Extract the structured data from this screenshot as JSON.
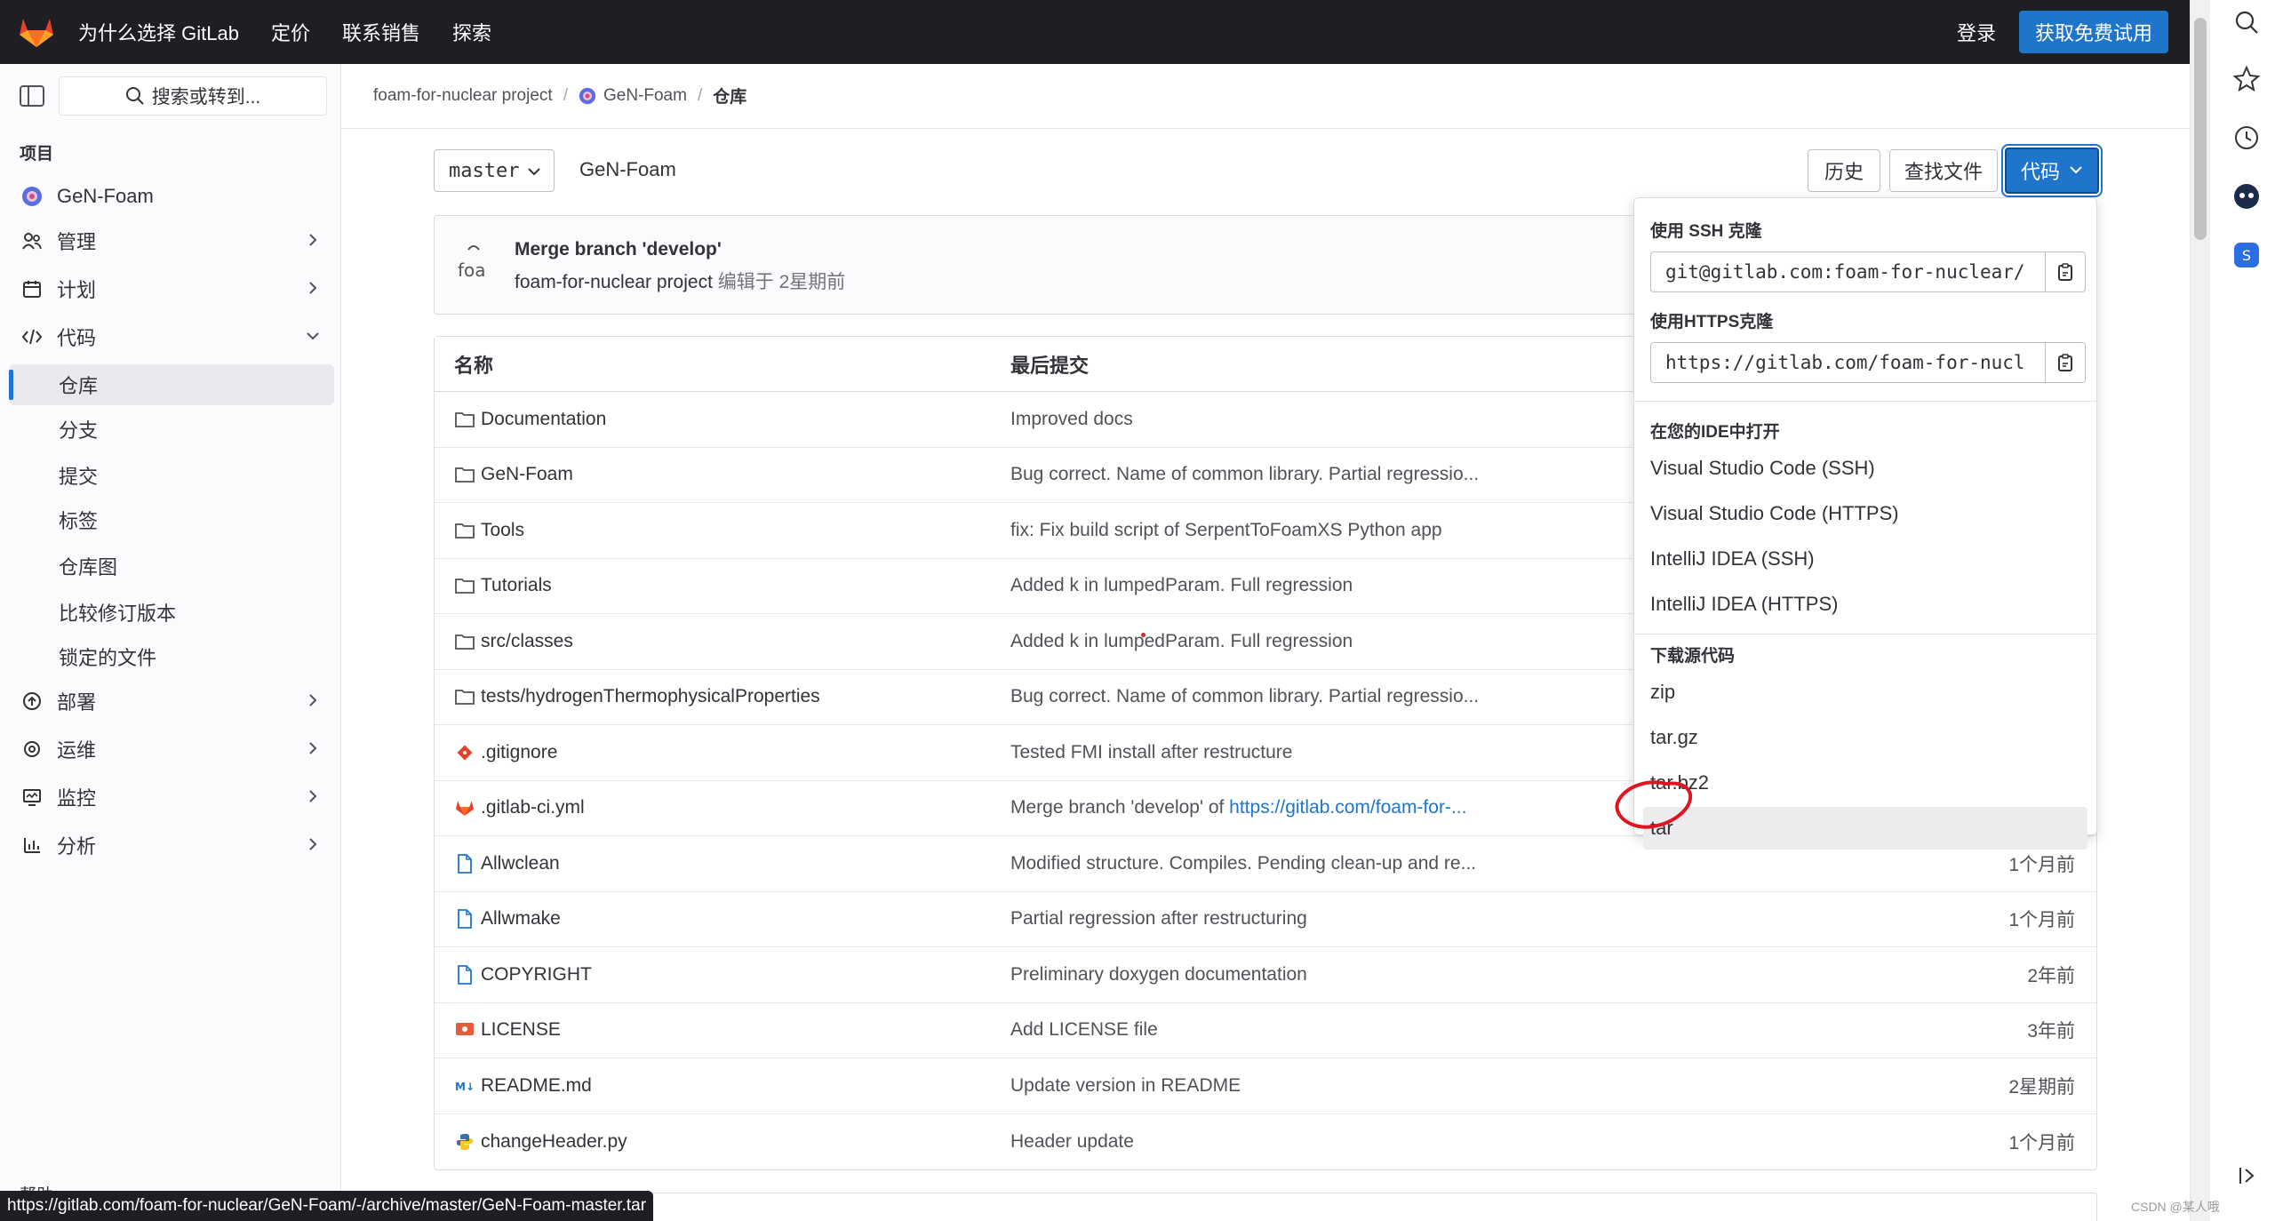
{
  "topbar": {
    "nav": [
      "为什么选择 GitLab",
      "定价",
      "联系销售",
      "探索"
    ],
    "login": "登录",
    "trial": "获取免费试用"
  },
  "sidebar": {
    "search_placeholder": "搜索或转到...",
    "section_title": "项目",
    "project_name": "GeN-Foam",
    "items": {
      "manage": "管理",
      "plan": "计划",
      "code": "代码",
      "deploy": "部署",
      "operate": "运维",
      "monitor": "监控",
      "analyze": "分析"
    },
    "code_sub": [
      "仓库",
      "分支",
      "提交",
      "标签",
      "仓库图",
      "比较修订版本",
      "锁定的文件"
    ],
    "help": "帮助"
  },
  "breadcrumb": {
    "group": "foam-for-nuclear project",
    "project": "GeN-Foam",
    "current": "仓库"
  },
  "toolbar": {
    "branch": "master",
    "path": "GeN-Foam",
    "history": "历史",
    "find_file": "查找文件",
    "code": "代码"
  },
  "commit": {
    "avatar_text": "foa",
    "title": "Merge branch 'develop'",
    "author": "foam-for-nuclear project",
    "action": "编辑于",
    "time": "2星期前"
  },
  "table": {
    "headers": {
      "name": "名称",
      "last_commit": "最后提交",
      "last_update": ""
    },
    "rows": [
      {
        "name": "Documentation",
        "icon": "folder-icon",
        "commit": "Improved docs",
        "date": ""
      },
      {
        "name": "GeN-Foam",
        "icon": "folder-icon",
        "commit": "Bug correct. Name of common library. Partial regressio...",
        "date": ""
      },
      {
        "name": "Tools",
        "icon": "folder-icon",
        "commit": "fix: Fix build script of SerpentToFoamXS Python app",
        "date": ""
      },
      {
        "name": "Tutorials",
        "icon": "folder-icon",
        "commit": "Added k in lumpedParam. Full regression",
        "date": ""
      },
      {
        "name": "src/classes",
        "icon": "folder-icon",
        "commit": "Added k in lumpedParam. Full regression",
        "date": ""
      },
      {
        "name": "tests/hydrogenThermophysicalProperties",
        "icon": "folder-icon",
        "commit": "Bug correct. Name of common library. Partial regressio...",
        "date": ""
      },
      {
        "name": ".gitignore",
        "icon": "git-icon",
        "commit": "Tested FMI install after restructure",
        "date": ""
      },
      {
        "name": ".gitlab-ci.yml",
        "icon": "gitlab-icon",
        "commit": "Merge branch 'develop' of ",
        "link": "https://gitlab.com/foam-for-...",
        "date": ""
      },
      {
        "name": "Allwclean",
        "icon": "file-icon",
        "commit": "Modified structure. Compiles. Pending clean-up and re...",
        "date": "1个月前"
      },
      {
        "name": "Allwmake",
        "icon": "file-icon",
        "commit": "Partial regression after restructuring",
        "date": "1个月前"
      },
      {
        "name": "COPYRIGHT",
        "icon": "file-icon",
        "commit": "Preliminary doxygen documentation",
        "date": "2年前"
      },
      {
        "name": "LICENSE",
        "icon": "license-icon",
        "commit": "Add LICENSE file",
        "date": "3年前"
      },
      {
        "name": "README.md",
        "icon": "markdown-icon",
        "commit": "Update version in README",
        "date": "2星期前"
      },
      {
        "name": "changeHeader.py",
        "icon": "python-icon",
        "commit": "Header update",
        "date": "1个月前"
      }
    ]
  },
  "dropdown": {
    "ssh_label": "使用 SSH 克隆",
    "ssh_url": "git@gitlab.com:foam-for-nuclear/",
    "https_label": "使用HTTPS克隆",
    "https_url": "https://gitlab.com/foam-for-nucl",
    "ide_label": "在您的IDE中打开",
    "ide_items": [
      "Visual Studio Code (SSH)",
      "Visual Studio Code (HTTPS)",
      "IntelliJ IDEA (SSH)",
      "IntelliJ IDEA (HTTPS)"
    ],
    "download_label": "下载源代码",
    "download_items": [
      "zip",
      "tar.gz",
      "tar.bz2",
      "tar"
    ]
  },
  "status_url": "https://gitlab.com/foam-for-nuclear/GeN-Foam/-/archive/master/GeN-Foam-master.tar",
  "watermark": "CSDN @某人哦",
  "colors": {
    "topbar": "#1f1e24",
    "accent": "#1f75cb",
    "annotation": "#e0141e"
  }
}
